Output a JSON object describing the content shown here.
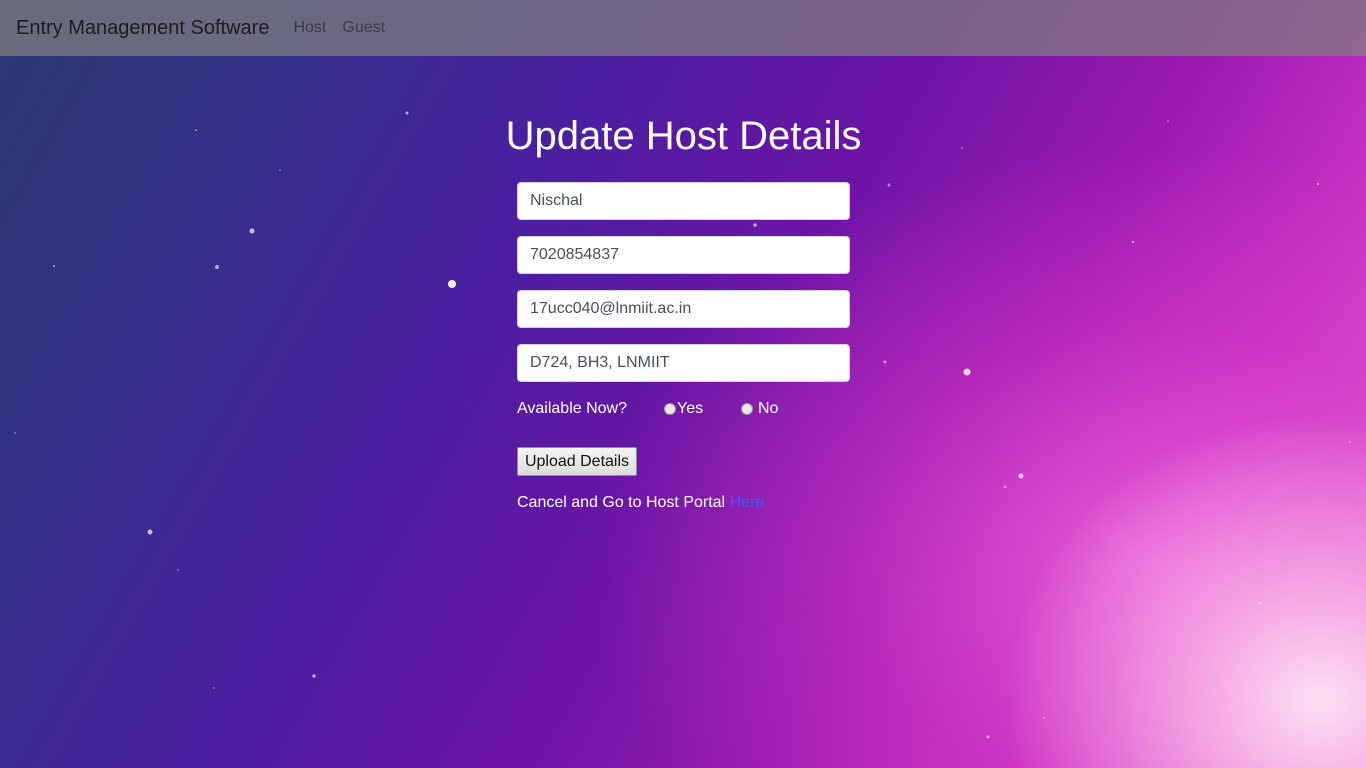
{
  "navbar": {
    "brand": "Entry Management Software",
    "links": [
      "Host",
      "Guest"
    ]
  },
  "form": {
    "title": "Update Host Details",
    "fields": {
      "name": "Nischal",
      "phone": "7020854837",
      "email": "17ucc040@lnmiit.ac.in",
      "address": "D724, BH3, LNMIIT"
    },
    "availability": {
      "label": "Available Now?",
      "options": [
        "Yes",
        "No"
      ]
    },
    "submit_label": "Upload Details",
    "cancel_text": "Cancel and Go to Host Portal ",
    "cancel_link": "Here"
  },
  "colors": {
    "link": "#3a5cff",
    "navbar_bg": "rgba(128,128,128,0.72)"
  }
}
